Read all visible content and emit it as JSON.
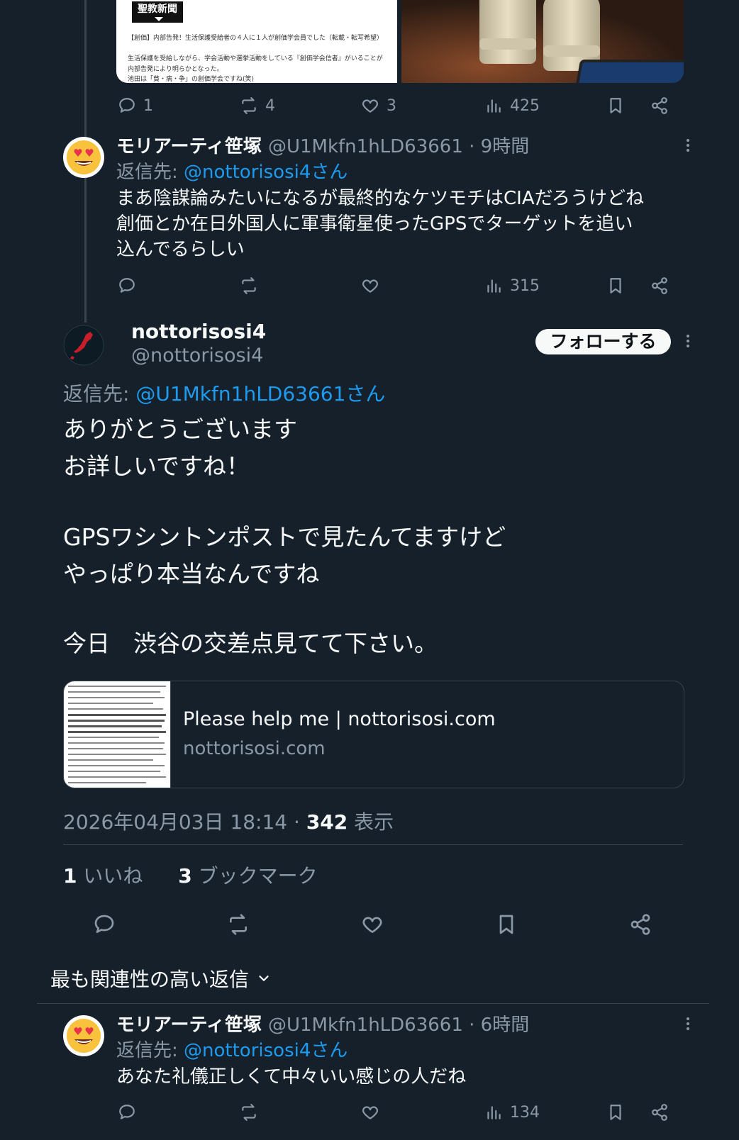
{
  "prev_tweet": {
    "media_left": {
      "logo_text": "聖教新聞",
      "headline": "【創価】内部告発！生活保護受給者の４人に１人が創価学会員でした（転載・転写希望）",
      "line2": "生活保護を受給しながら、学会活動や選挙活動をしている『創価学会信者』がいることが",
      "line3": "内部告発により明らかとなった。",
      "line4": "池田は「貧・病・争」の創価学会ですね(笑)"
    },
    "actions": {
      "reply": "1",
      "retweet": "4",
      "like": "3",
      "views": "425"
    }
  },
  "reply1": {
    "name": "モリアーティ笹塚",
    "handle": "@U1Mkfn1hLD63661",
    "time": " · 9時間",
    "reply_to_prefix": "返信先: ",
    "reply_to": "@nottorisosi4さん",
    "lines": [
      "まあ陰謀論みたいになるが最終的なケツモチはCIAだろうけどね",
      "創価とか在日外国人に軍事衛星使ったGPSでターゲットを追い",
      "込んでるらしい"
    ],
    "views": "315"
  },
  "main": {
    "name": "nottorisosi4",
    "handle": "@nottorisosi4",
    "follow_label": "フォローする",
    "reply_to_prefix": "返信先: ",
    "reply_to": "@U1Mkfn1hLD63661さん",
    "lines": [
      "ありがとうございます",
      "お詳しいですね！",
      "GPSワシントンポストで見たんてますけど",
      "やっぱり本当なんですね",
      "今日　渋谷の交差点見てて下さい。"
    ],
    "card": {
      "title": "Please help me | nottorisosi.com",
      "domain": "nottorisosi.com"
    },
    "timestamp": "2026年04月03日 18:14 · ",
    "views_count": "342",
    "views_label": " 表示",
    "likes_count": "1",
    "likes_label": " いいね",
    "bookmarks_count": "3",
    "bookmarks_label": " ブックマーク"
  },
  "sort_label": "最も関連性の高い返信",
  "reply2": {
    "name": "モリアーティ笹塚",
    "handle": "@U1Mkfn1hLD63661",
    "time": " · 6時間",
    "reply_to_prefix": "返信先: ",
    "reply_to": "@nottorisosi4さん",
    "text": "あなた礼儀正しくて中々いい感じの人だね",
    "views": "134"
  },
  "colors": {
    "background": "#15202b",
    "text": "#f7f9f9",
    "muted": "#8b98a5",
    "accent": "#1d9bf0",
    "border": "#38444d"
  }
}
